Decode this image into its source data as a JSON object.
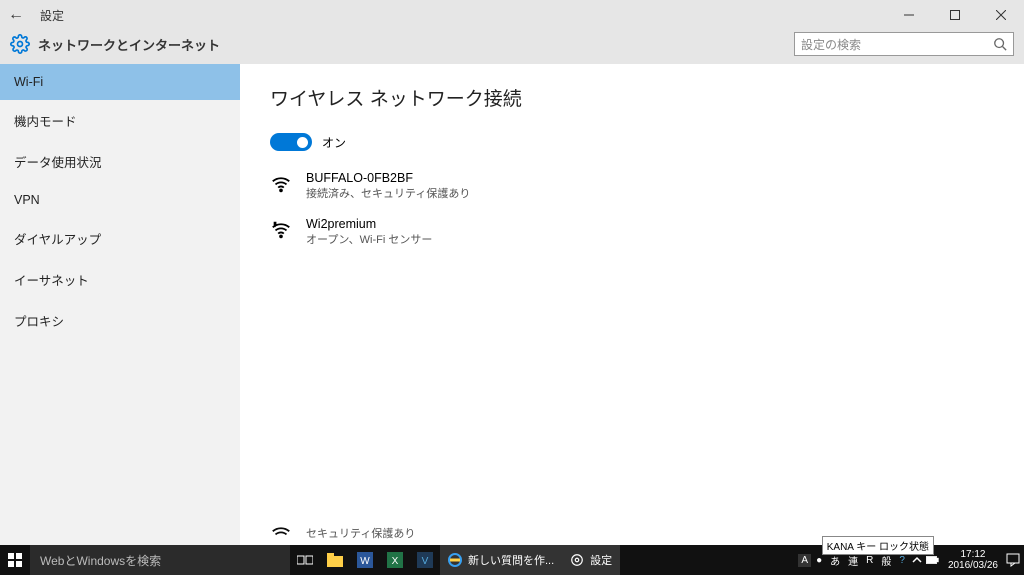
{
  "window": {
    "title": "設定"
  },
  "header": {
    "section": "ネットワークとインターネット",
    "search_placeholder": "設定の検索"
  },
  "sidebar": {
    "items": [
      {
        "label": "Wi-Fi",
        "active": true
      },
      {
        "label": "機内モード"
      },
      {
        "label": "データ使用状況"
      },
      {
        "label": "VPN"
      },
      {
        "label": "ダイヤルアップ"
      },
      {
        "label": "イーサネット"
      },
      {
        "label": "プロキシ"
      }
    ]
  },
  "main": {
    "heading": "ワイヤレス ネットワーク接続",
    "toggle_label": "オン",
    "networks": [
      {
        "name": "BUFFALO-0FB2BF",
        "desc": "接続済み、セキュリティ保護あり",
        "open": false
      },
      {
        "name": "Wi2premium",
        "desc": "オープン、Wi-Fi センサー",
        "open": true
      }
    ],
    "cutoff_desc": "セキュリティ保護あり"
  },
  "taskbar": {
    "search_placeholder": "WebとWindowsを検索",
    "tasks": [
      {
        "label": "新しい質問を作..."
      },
      {
        "label": "設定"
      }
    ],
    "ime": "A",
    "ime_indicators": [
      "あ",
      "連",
      "R",
      "般"
    ],
    "tooltip": "KANA キー ロック状態",
    "time": "17:12",
    "date": "2016/03/26"
  }
}
